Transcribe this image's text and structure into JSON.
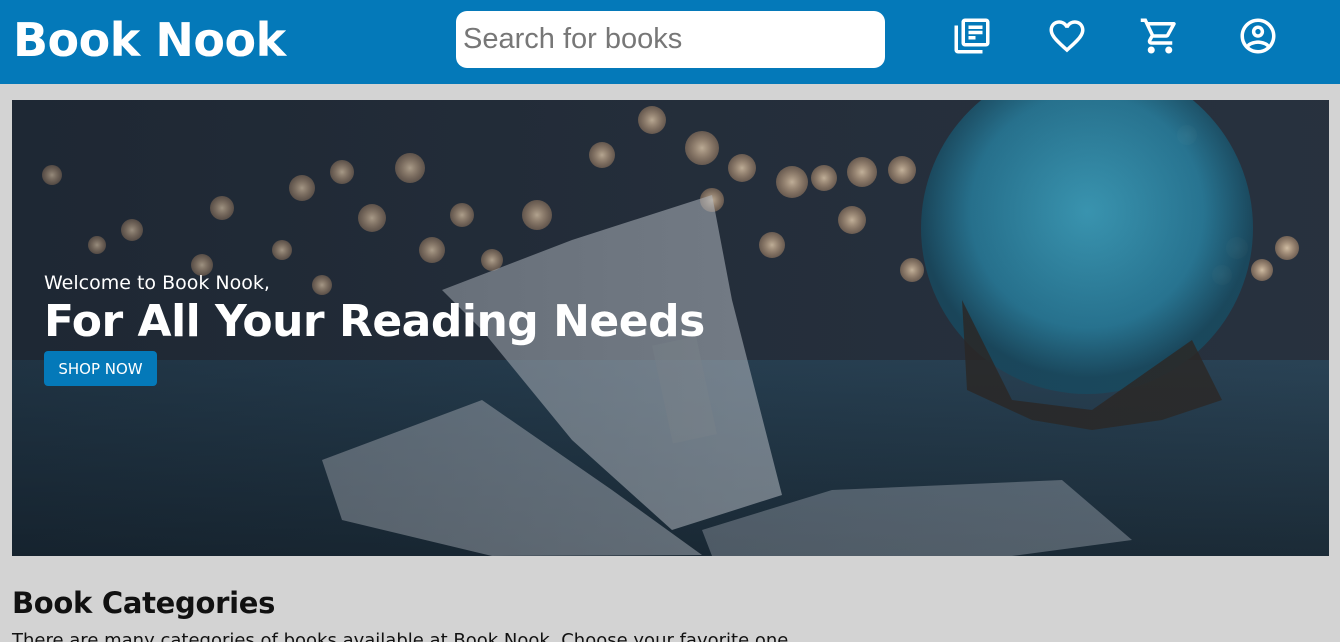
{
  "header": {
    "logo": "Book Nook",
    "search_placeholder": "Search for books",
    "icons": [
      "library-books-icon",
      "heart-icon",
      "shopping-cart-icon",
      "account-circle-icon"
    ],
    "color": "#0479b9"
  },
  "hero": {
    "welcome": "Welcome to Book Nook,",
    "headline": "For All Your Reading Needs",
    "cta_label": "SHOP NOW"
  },
  "categories": {
    "title": "Book Categories",
    "description": "There are many categories of books available at Book Nook. Choose your favorite one"
  }
}
